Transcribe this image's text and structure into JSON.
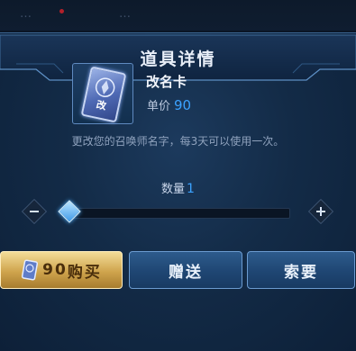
{
  "background_tabs": [
    "…",
    "…"
  ],
  "dialog": {
    "title": "道具详情"
  },
  "item": {
    "name": "改名卡",
    "card_label": "改",
    "price_label": "单价",
    "price": "90",
    "description": "更改您的召唤师名字，每3天可以使用一次。",
    "icon": "rename-card-icon"
  },
  "quantity": {
    "label": "数量",
    "value": "1",
    "slider_fraction": 0.0
  },
  "buttons": {
    "buy_price": "90",
    "buy_label": "购买",
    "gift_label": "赠送",
    "request_label": "索要"
  },
  "colors": {
    "accent_blue": "#3ba2ff",
    "gold": "#d8b060",
    "panel": "#132b47"
  }
}
